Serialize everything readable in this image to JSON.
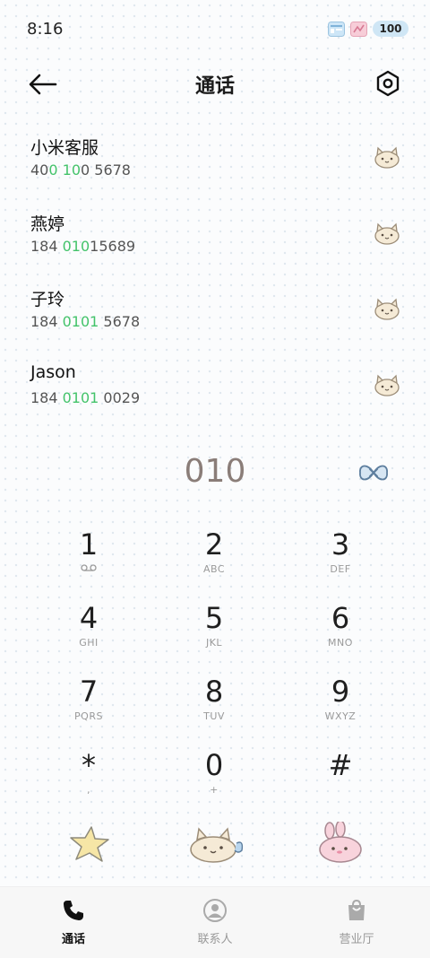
{
  "status_bar": {
    "time": "8:16",
    "battery": "100"
  },
  "header": {
    "title": "通话",
    "back_icon": "arrow-left-icon",
    "settings_icon": "hexagon-settings-icon"
  },
  "results": [
    {
      "name": "小米客服",
      "number_parts": [
        [
          "40",
          false
        ],
        [
          "0",
          true
        ],
        [
          " ",
          false
        ],
        [
          "10",
          true
        ],
        [
          "0 5678",
          false
        ]
      ]
    },
    {
      "name": "燕婷",
      "number_parts": [
        [
          "184 ",
          false
        ],
        [
          "010",
          true
        ],
        [
          "15689",
          false
        ]
      ]
    },
    {
      "name": "子玲",
      "number_parts": [
        [
          "184 ",
          false
        ],
        [
          "0101",
          true
        ],
        [
          " 5678",
          false
        ]
      ]
    },
    {
      "name": "Jason",
      "number_parts": [
        [
          "184 ",
          false
        ],
        [
          "0101",
          true
        ],
        [
          " 0029",
          false
        ]
      ]
    }
  ],
  "dialer": {
    "entered": "010"
  },
  "keypad": [
    {
      "digit": "1",
      "sub": "",
      "sub_icon": "voicemail-icon"
    },
    {
      "digit": "2",
      "sub": "ABC"
    },
    {
      "digit": "3",
      "sub": "DEF"
    },
    {
      "digit": "4",
      "sub": "GHI"
    },
    {
      "digit": "5",
      "sub": "JKL"
    },
    {
      "digit": "6",
      "sub": "MNO"
    },
    {
      "digit": "7",
      "sub": "PQRS"
    },
    {
      "digit": "8",
      "sub": "TUV"
    },
    {
      "digit": "9",
      "sub": "WXYZ"
    },
    {
      "digit": "*",
      "sub": ","
    },
    {
      "digit": "0",
      "sub": "+"
    },
    {
      "digit": "#",
      "sub": ""
    }
  ],
  "bottom_nav": [
    {
      "label": "通话",
      "icon": "phone-icon",
      "active": true
    },
    {
      "label": "联系人",
      "icon": "person-icon",
      "active": false
    },
    {
      "label": "营业厅",
      "icon": "shopping-bag-icon",
      "active": false
    }
  ],
  "colors": {
    "highlight": "#43c36a",
    "dial_text": "#8a7d78",
    "active_tab": "#111111",
    "inactive_tab": "#999999"
  }
}
